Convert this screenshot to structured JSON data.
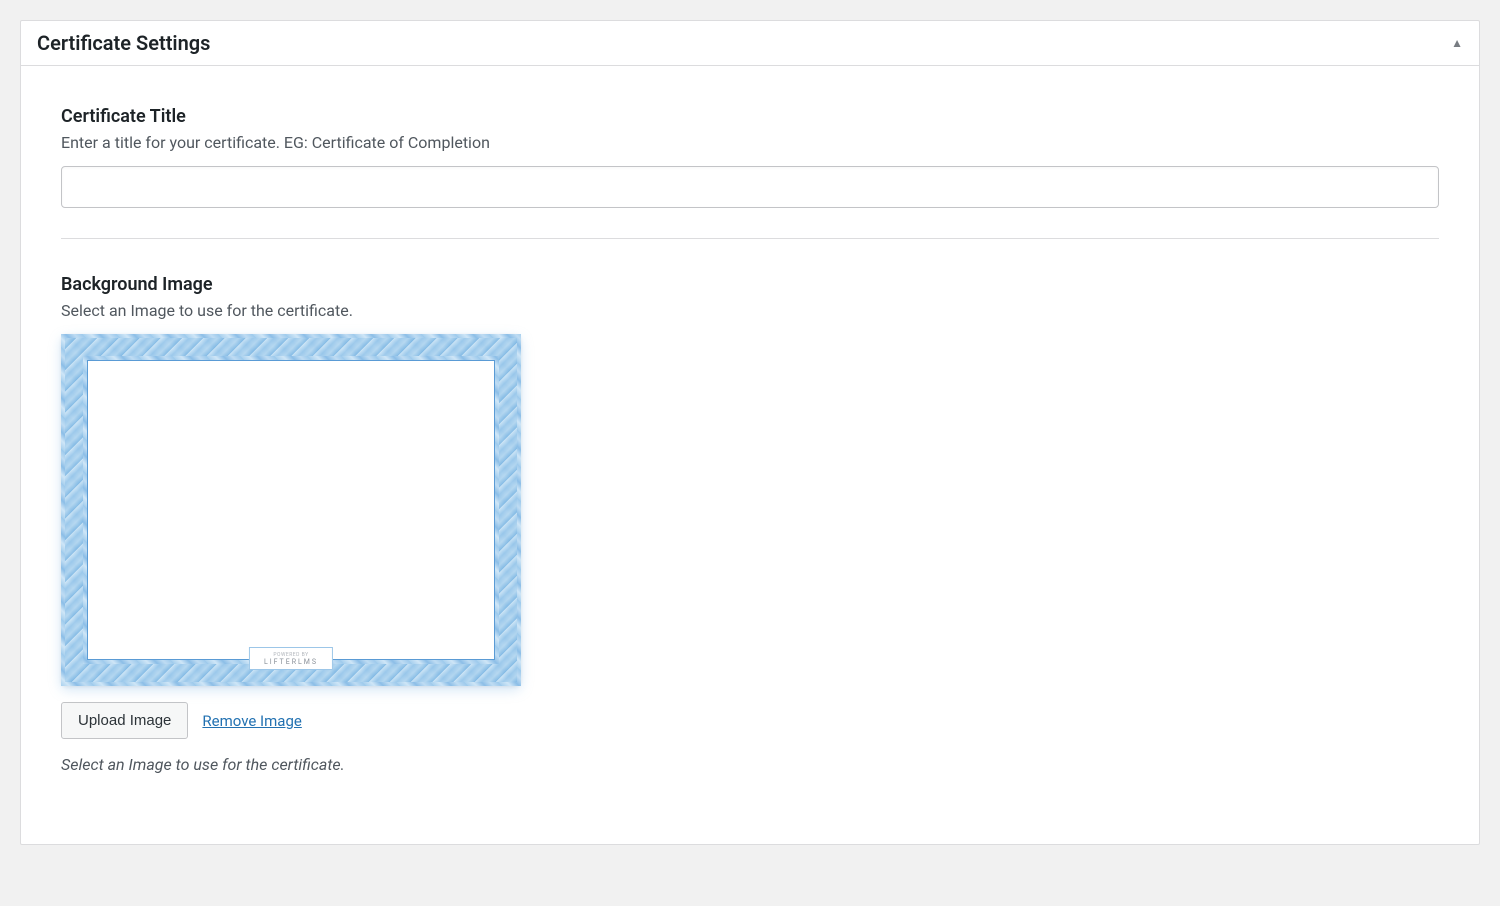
{
  "panel": {
    "title": "Certificate Settings"
  },
  "fields": {
    "certificateTitle": {
      "label": "Certificate Title",
      "description": "Enter a title for your certificate. EG: Certificate of Completion",
      "value": ""
    },
    "backgroundImage": {
      "label": "Background Image",
      "description": "Select an Image to use for the certificate.",
      "uploadButton": "Upload Image",
      "removeLink": "Remove Image",
      "helpText": "Select an Image to use for the certificate.",
      "preview": {
        "badgeTop": "POWERED BY",
        "badgeText": "LIFTERLMS"
      }
    }
  }
}
